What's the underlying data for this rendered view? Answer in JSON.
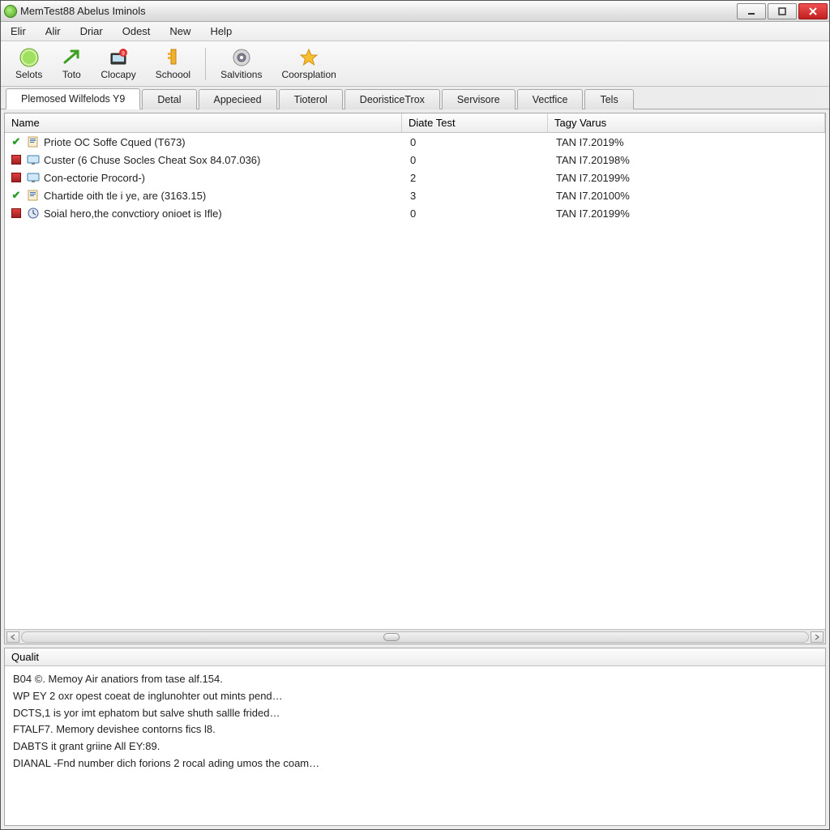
{
  "titlebar": {
    "title": "MemTest88 Abelus Iminols"
  },
  "menubar": [
    "Elir",
    "Alir",
    "Driar",
    "Odest",
    "New",
    "Help"
  ],
  "toolbar": [
    {
      "label": "Selots",
      "icon": "play-green"
    },
    {
      "label": "Toto",
      "icon": "arrow-green"
    },
    {
      "label": "Clocapy",
      "icon": "monitor-badge"
    },
    {
      "label": "Schoool",
      "icon": "key-yellow"
    },
    {
      "sep": true
    },
    {
      "label": "Salvitions",
      "icon": "disc-grey"
    },
    {
      "label": "Coorsplation",
      "icon": "star-yellow"
    }
  ],
  "tabs": [
    {
      "label": "Plemosed Wilfelods Y9",
      "active": true
    },
    {
      "label": "Detal"
    },
    {
      "label": "Appecieed"
    },
    {
      "label": "Tioterol"
    },
    {
      "label": "DeoristiceTrox"
    },
    {
      "label": "Servisore"
    },
    {
      "label": "Vectfice"
    },
    {
      "label": "Tels"
    }
  ],
  "columns": {
    "name": "Name",
    "test": "Diate Test",
    "tag": "Tagy Varus"
  },
  "rows": [
    {
      "status": "ok",
      "icon": "doc",
      "name": "Priote OC Soffe Cqued (T673)",
      "test": "0",
      "tag": "TAN I7.2019%"
    },
    {
      "status": "err",
      "icon": "monitor",
      "name": "Custer (6 Chuse Socles Cheat Sox 84.07.036)",
      "test": "0",
      "tag": "TAN I7.20198%"
    },
    {
      "status": "err",
      "icon": "monitor",
      "name": "Con-ectorie Procord-)",
      "test": "2",
      "tag": "TAN I7.20199%"
    },
    {
      "status": "ok",
      "icon": "doc",
      "name": "Chartide oith tle i ye, are (3163.15)",
      "test": "3",
      "tag": "TAN I7.20100%"
    },
    {
      "status": "err",
      "icon": "clock",
      "name": "Soial hero,the convctiory onioet is Ifle)",
      "test": "0",
      "tag": "TAN I7.20199%"
    }
  ],
  "log": {
    "header": "Qualit",
    "lines": [
      "B04 ©. Memoy Air anatiors from tase alf.154.",
      "WP EY 2 oxr opest coeat de inglunohter out mints pend…",
      "DCTS,1 is yor imt ephatom but salve shuth sallle frided…",
      "FTALF7. Memory devishee contorns fics l8.",
      "DABTS it grant griine All EY:89.",
      "DIANAL -Fnd number dich forions 2 rocal ading umos the coam…"
    ]
  }
}
